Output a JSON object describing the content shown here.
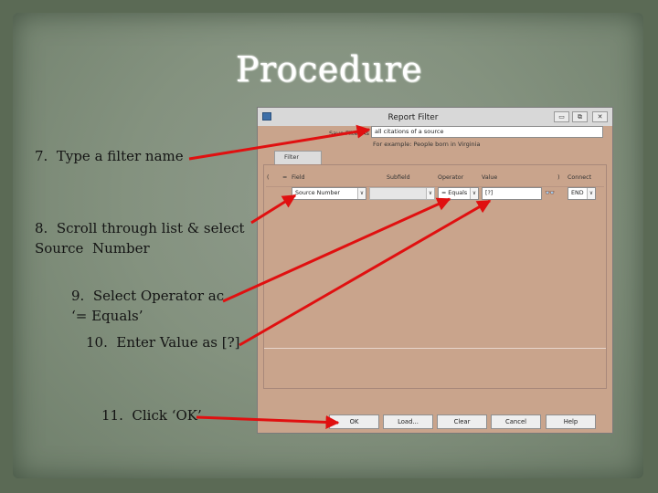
{
  "slide": {
    "title": "Procedure"
  },
  "steps": {
    "s7": "7.  Type a filter name",
    "s8_line1": "8.  Scroll through list & select",
    "s8_line2": "Source  Number",
    "s9_line1": "9.  Select Operator ac",
    "s9_line2": "‘= Equals’",
    "s10": "10.  Enter Value as [?]",
    "s11": "11.  Click ‘OK’"
  },
  "dialog": {
    "title": "Report Filter",
    "window_buttons": {
      "minimize": "▭",
      "maximize": "⧉",
      "close": "✕"
    },
    "save_filter_label": "Save Filter As",
    "save_filter_value": "all citations of a source",
    "example_text": "For example: People born in Virginia",
    "tab_label": "Filter",
    "headers": {
      "open_paren": "(",
      "not": "=",
      "field": "Field",
      "subfield": "Subfield",
      "operator": "Operator",
      "value": "Value",
      "close_paren": ")",
      "connect": "Connect"
    },
    "row": {
      "field": "Source Number",
      "subfield": "",
      "operator": "=   Equals",
      "value": "[?]",
      "connect": "END"
    },
    "dropdown_glyph": "∨",
    "binoculars_glyph": "👓",
    "buttons": {
      "ok": "OK",
      "load": "Load...",
      "clear": "Clear",
      "cancel": "Cancel",
      "help": "Help"
    }
  },
  "colors": {
    "arrow": "#e01010",
    "dialog_body": "#c9a48c",
    "slide_bg": "#84927f"
  }
}
